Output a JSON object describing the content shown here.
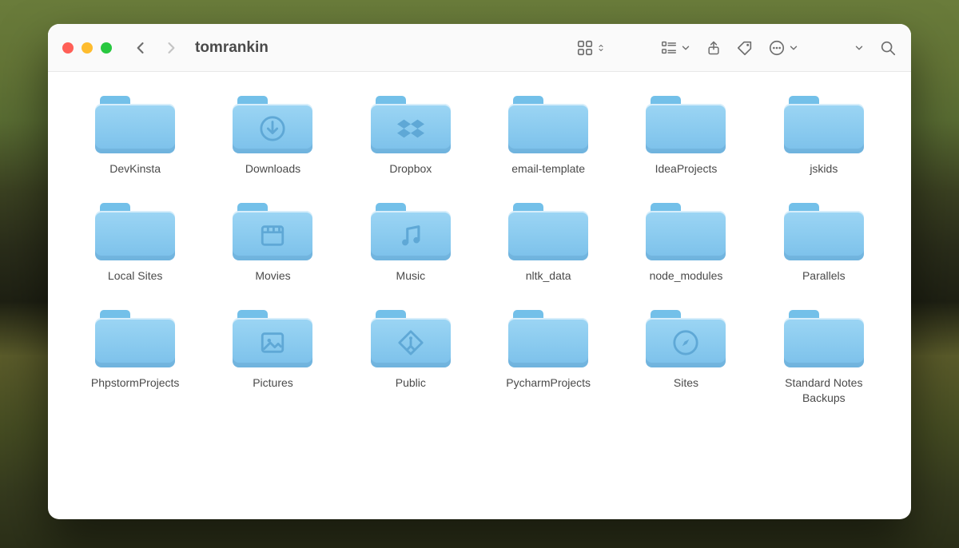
{
  "window": {
    "title": "tomrankin"
  },
  "folders": [
    {
      "name": "DevKinsta",
      "glyph": "none"
    },
    {
      "name": "Downloads",
      "glyph": "download"
    },
    {
      "name": "Dropbox",
      "glyph": "dropbox"
    },
    {
      "name": "email-template",
      "glyph": "none"
    },
    {
      "name": "IdeaProjects",
      "glyph": "none"
    },
    {
      "name": "jskids",
      "glyph": "none"
    },
    {
      "name": "Local Sites",
      "glyph": "none"
    },
    {
      "name": "Movies",
      "glyph": "film"
    },
    {
      "name": "Music",
      "glyph": "music"
    },
    {
      "name": "nltk_data",
      "glyph": "none"
    },
    {
      "name": "node_modules",
      "glyph": "none"
    },
    {
      "name": "Parallels",
      "glyph": "none"
    },
    {
      "name": "PhpstormProjects",
      "glyph": "none"
    },
    {
      "name": "Pictures",
      "glyph": "image"
    },
    {
      "name": "Public",
      "glyph": "public"
    },
    {
      "name": "PycharmProjects",
      "glyph": "none"
    },
    {
      "name": "Sites",
      "glyph": "compass"
    },
    {
      "name": "Standard Notes Backups",
      "glyph": "none"
    }
  ]
}
